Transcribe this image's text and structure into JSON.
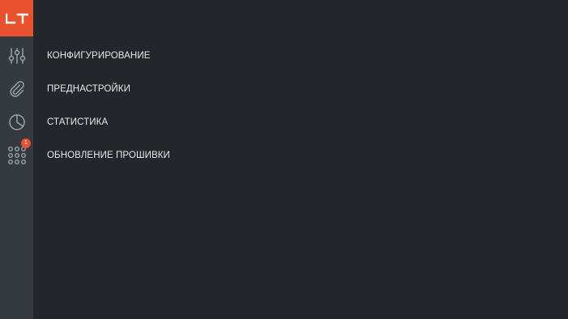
{
  "brand": {
    "logo_text": "LT",
    "accent_color": "#e8522f"
  },
  "rail": {
    "icons": [
      {
        "name": "sliders-icon"
      },
      {
        "name": "paperclip-icon"
      },
      {
        "name": "pie-chart-icon"
      },
      {
        "name": "apps-grid-icon",
        "badge": "1"
      }
    ]
  },
  "menu": {
    "items": [
      {
        "label": "КОНФИГУРИРОВАНИЕ"
      },
      {
        "label": "ПРЕДНАСТРОЙКИ"
      },
      {
        "label": "СТАТИСТИКА"
      },
      {
        "label": "ОБНОВЛЕНИЕ ПРОШИВКИ"
      }
    ]
  },
  "colors": {
    "background": "#23272b",
    "rail": "#343a40",
    "icon": "#9aa1a8",
    "text": "#e6e8ea",
    "badge": "#e8522f"
  }
}
